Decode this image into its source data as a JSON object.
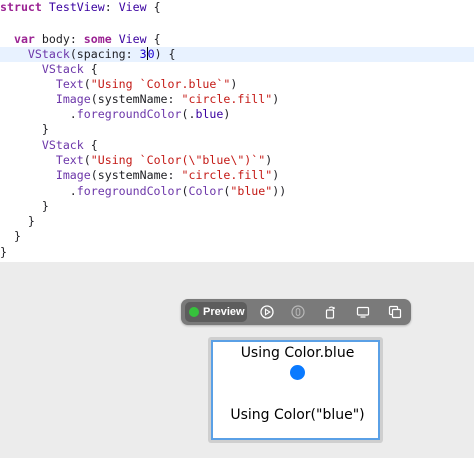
{
  "editor": {
    "lines": [
      "struct TestView: View {",
      "",
      "  var body: some View {",
      "    VStack(spacing: 30) {",
      "      VStack {",
      "        Text(\"Using `Color.blue`\")",
      "        Image(systemName: \"circle.fill\")",
      "          .foregroundColor(.blue)",
      "      }",
      "      VStack {",
      "        Text(\"Using `Color(\\\"blue\\\")`\")",
      "        Image(systemName: \"circle.fill\")",
      "          .foregroundColor(Color(\"blue\"))",
      "      }",
      "    }",
      "  }",
      "}"
    ],
    "current_line": 4
  },
  "toolbar": {
    "preview_label": "Preview",
    "buttons": [
      "live-preview-icon",
      "inspect-icon",
      "rotate-icon",
      "device-icon",
      "duplicate-icon"
    ]
  },
  "preview": {
    "text1": "Using Color.blue",
    "text2": "Using Color(\"blue\")",
    "circle_color": "#0a7aff"
  },
  "colors": {
    "keyword": "#9b2393",
    "string": "#c41a16",
    "number": "#1c00cf",
    "selection_border": "#5aa0e6",
    "live_indicator": "#36c23c"
  }
}
